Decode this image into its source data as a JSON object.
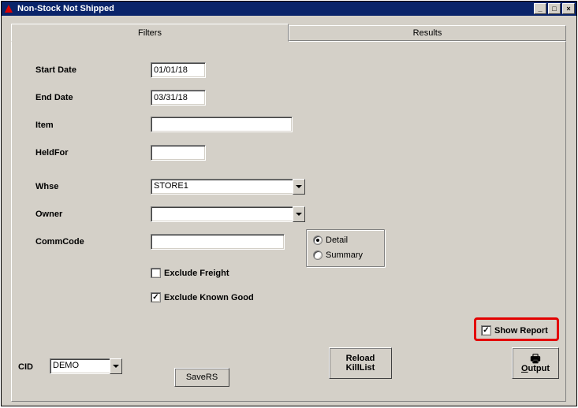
{
  "window": {
    "title": "Non-Stock Not Shipped"
  },
  "tabs": {
    "filters": "Filters",
    "results": "Results"
  },
  "labels": {
    "start_date": "Start Date",
    "end_date": "End Date",
    "item": "Item",
    "held_for": "HeldFor",
    "whse": "Whse",
    "owner": "Owner",
    "comm_code": "CommCode",
    "cid": "CID"
  },
  "fields": {
    "start_date": "01/01/18",
    "end_date": "03/31/18",
    "item": "",
    "held_for": "",
    "whse": "STORE1",
    "owner": "",
    "comm_code": "",
    "cid": "DEMO"
  },
  "radios": {
    "detail": "Detail",
    "summary": "Summary",
    "selected": "detail"
  },
  "checks": {
    "exclude_freight": {
      "label": "Exclude Freight",
      "checked": false
    },
    "exclude_known_good": {
      "label": "Exclude Known Good",
      "checked": true
    },
    "show_report": {
      "label": "Show Report",
      "checked": true
    }
  },
  "buttons": {
    "save_rs": "SaveRS",
    "reload_killlist_line1": "Reload",
    "reload_killlist_line2": "KillList",
    "output": "Output"
  }
}
